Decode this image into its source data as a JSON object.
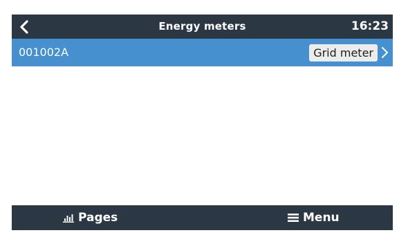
{
  "header": {
    "title": "Energy meters",
    "time": "16:23",
    "back_icon": "chevron-left-icon"
  },
  "list": {
    "items": [
      {
        "label": "001002A",
        "value": "Grid meter",
        "icon": "chevron-right-icon"
      }
    ]
  },
  "footer": {
    "pages_label": "Pages",
    "pages_icon": "bar-chart-icon",
    "menu_label": "Menu",
    "menu_icon": "hamburger-icon"
  },
  "colors": {
    "header_bg": "#2c3744",
    "selected_row_bg": "#4790d0",
    "value_box_bg": "#ececec"
  }
}
